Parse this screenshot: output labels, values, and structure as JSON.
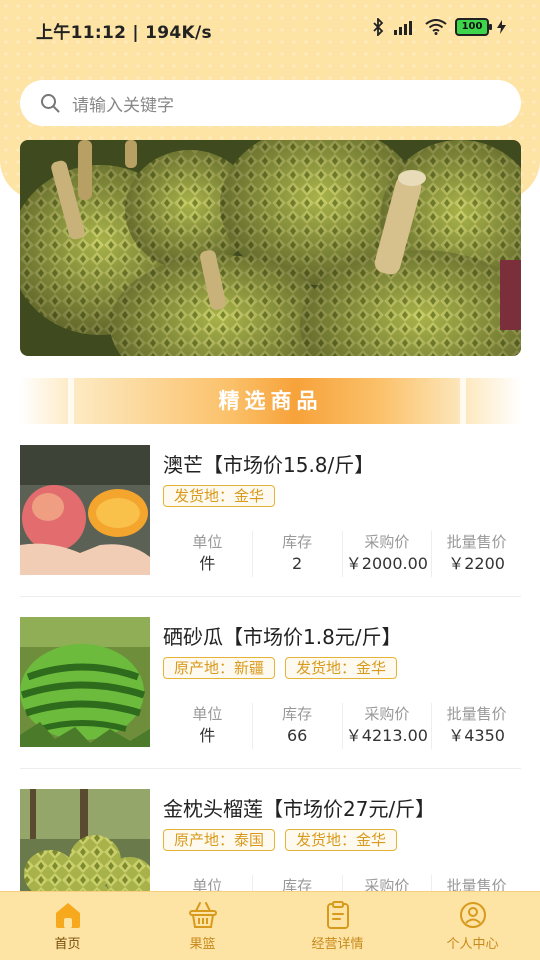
{
  "status_bar": {
    "time": "上午11:12 | 194K/s",
    "battery": "100"
  },
  "search": {
    "placeholder": "请输入关键字"
  },
  "section": {
    "title": "精选商品"
  },
  "stat_labels": {
    "unit": "单位",
    "stock": "库存",
    "purchase_price": "采购价",
    "wholesale_price": "批量售价"
  },
  "products": [
    {
      "name": "澳芒【市场价15.8/斤】",
      "tags": [
        "发货地：金华"
      ],
      "unit": "件",
      "stock": "2",
      "purchase_price": "￥2000.00",
      "wholesale_price": "￥2200"
    },
    {
      "name": "硒砂瓜【市场价1.8元/斤】",
      "tags": [
        "原产地：新疆",
        "发货地：金华"
      ],
      "unit": "件",
      "stock": "66",
      "purchase_price": "￥4213.00",
      "wholesale_price": "￥4350"
    },
    {
      "name": "金枕头榴莲【市场价27元/斤】",
      "tags": [
        "原产地：泰国",
        "发货地：金华"
      ],
      "unit": "",
      "stock": "",
      "purchase_price": "",
      "wholesale_price": ""
    }
  ],
  "tabbar": {
    "items": [
      {
        "label": "首页",
        "icon": "home-icon"
      },
      {
        "label": "果篮",
        "icon": "basket-icon"
      },
      {
        "label": "经营详情",
        "icon": "clipboard-icon"
      },
      {
        "label": "个人中心",
        "icon": "user-icon"
      }
    ],
    "active_color": "#7a4d07",
    "inactive_color": "#c68a1c"
  },
  "colors": {
    "accent": "#f7a23a",
    "header_bg": "#fde3a4",
    "tag": "#e6b33a"
  }
}
